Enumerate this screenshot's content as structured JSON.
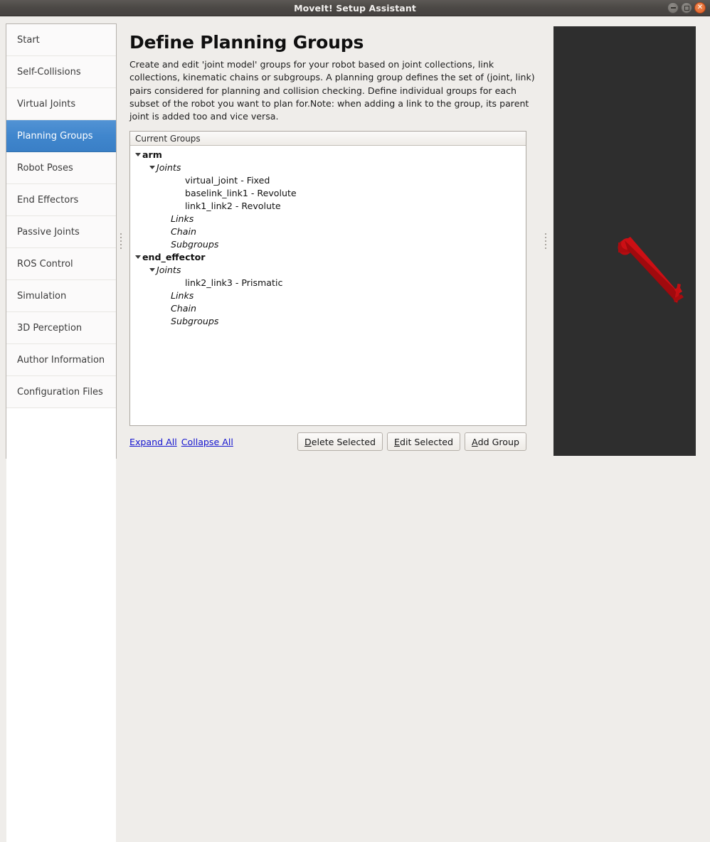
{
  "window": {
    "title": "MoveIt! Setup Assistant",
    "buttons": {
      "minimize": "minimize-button",
      "maximize": "maximize-button",
      "close": "close-button"
    }
  },
  "sidebar": {
    "items": [
      {
        "label": "Start",
        "selected": false
      },
      {
        "label": "Self-Collisions",
        "selected": false
      },
      {
        "label": "Virtual Joints",
        "selected": false
      },
      {
        "label": "Planning Groups",
        "selected": true
      },
      {
        "label": "Robot Poses",
        "selected": false
      },
      {
        "label": "End Effectors",
        "selected": false
      },
      {
        "label": "Passive Joints",
        "selected": false
      },
      {
        "label": "ROS Control",
        "selected": false
      },
      {
        "label": "Simulation",
        "selected": false
      },
      {
        "label": "3D Perception",
        "selected": false
      },
      {
        "label": "Author Information",
        "selected": false
      },
      {
        "label": "Configuration Files",
        "selected": false
      }
    ]
  },
  "main": {
    "title": "Define Planning Groups",
    "description": "Create and edit 'joint model' groups for your robot based on joint collections, link collections, kinematic chains or subgroups. A planning group defines the set of (joint, link) pairs considered for planning and collision checking. Define individual groups for each subset of the robot you want to plan for.Note: when adding a link to the group, its parent joint is added too and vice versa.",
    "tree": {
      "header": "Current Groups",
      "rows": [
        {
          "label": "arm",
          "indent": 0,
          "arrow": true,
          "style": "group"
        },
        {
          "label": "Joints",
          "indent": 1,
          "arrow": true,
          "style": "category"
        },
        {
          "label": "virtual_joint - Fixed",
          "indent": 3,
          "arrow": false,
          "style": "leaf"
        },
        {
          "label": "baselink_link1 - Revolute",
          "indent": 3,
          "arrow": false,
          "style": "leaf"
        },
        {
          "label": "link1_link2 - Revolute",
          "indent": 3,
          "arrow": false,
          "style": "leaf"
        },
        {
          "label": "Links",
          "indent": 2,
          "arrow": false,
          "style": "category"
        },
        {
          "label": "Chain",
          "indent": 2,
          "arrow": false,
          "style": "category"
        },
        {
          "label": "Subgroups",
          "indent": 2,
          "arrow": false,
          "style": "category"
        },
        {
          "label": "end_effector",
          "indent": 0,
          "arrow": true,
          "style": "group"
        },
        {
          "label": "Joints",
          "indent": 1,
          "arrow": true,
          "style": "category"
        },
        {
          "label": "link2_link3 - Prismatic",
          "indent": 3,
          "arrow": false,
          "style": "leaf"
        },
        {
          "label": "Links",
          "indent": 2,
          "arrow": false,
          "style": "category"
        },
        {
          "label": "Chain",
          "indent": 2,
          "arrow": false,
          "style": "category"
        },
        {
          "label": "Subgroups",
          "indent": 2,
          "arrow": false,
          "style": "category"
        }
      ]
    },
    "links": [
      {
        "label": "Expand All"
      },
      {
        "label": "Collapse All"
      }
    ],
    "buttons": [
      {
        "mnemonic": "D",
        "rest": "elete Selected"
      },
      {
        "mnemonic": "E",
        "rest": "dit Selected"
      },
      {
        "mnemonic": "A",
        "rest": "dd Group"
      }
    ]
  },
  "viewport": {
    "name": "rviz-3d-view",
    "background_color": "#2e2e2e",
    "robot_color": "#cc0f14"
  },
  "colors": {
    "accent": "#4086cd",
    "window_bg": "#efedea",
    "link": "#1414cf",
    "titlebar": "#4b4845"
  }
}
